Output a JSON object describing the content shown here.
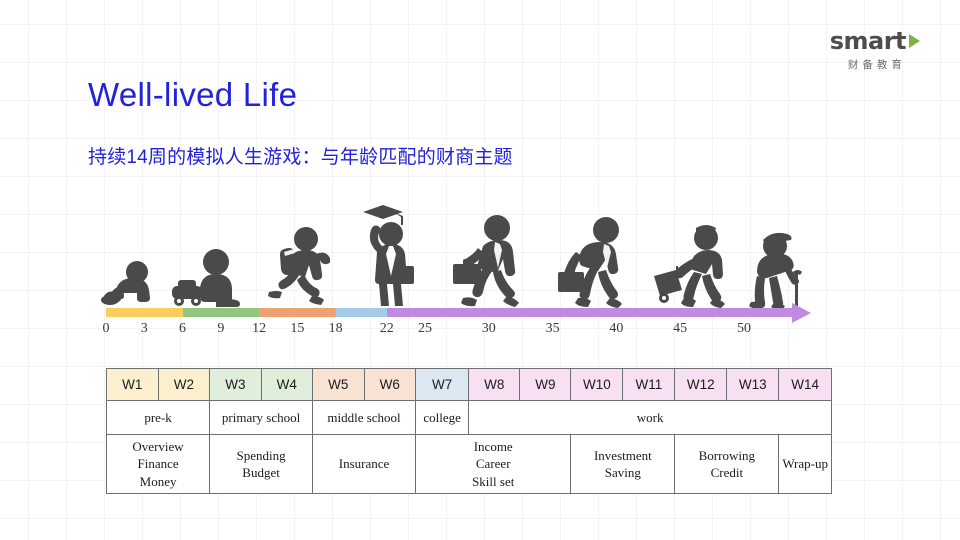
{
  "logo": {
    "wordmark": "smart",
    "chinese": "财备教育",
    "accent_color": "#7cb342",
    "icon": "play-triangle-icon"
  },
  "heading": {
    "title": "Well-lived Life",
    "subtitle": "持续14周的模拟人生游戏：与年龄匹配的财商主题",
    "color": "#2222dd"
  },
  "timeline": {
    "ticks": [
      0,
      3,
      6,
      9,
      12,
      15,
      18,
      22,
      25,
      30,
      35,
      40,
      45,
      50
    ],
    "axis_max": 54,
    "segments": [
      {
        "label": "early-childhood",
        "from": 0,
        "to": 6,
        "color": "#f8ce5c"
      },
      {
        "label": "primary",
        "from": 6,
        "to": 12,
        "color": "#94c77e"
      },
      {
        "label": "middle",
        "from": 12,
        "to": 18,
        "color": "#f0a172"
      },
      {
        "label": "college",
        "from": 18,
        "to": 22,
        "color": "#a6cbe8"
      },
      {
        "label": "work",
        "from": 22,
        "to": 54,
        "color": "#c08ae0"
      }
    ],
    "figures": [
      {
        "name": "crawling-baby-icon",
        "age": 2
      },
      {
        "name": "toddler-with-toy-car-icon",
        "age": 8
      },
      {
        "name": "running-schoolkid-icon",
        "age": 15
      },
      {
        "name": "graduate-icon",
        "age": 22
      },
      {
        "name": "business-person-icon",
        "age": 30
      },
      {
        "name": "worker-with-briefcase-icon",
        "age": 38
      },
      {
        "name": "traveler-with-suitcase-icon",
        "age": 46
      },
      {
        "name": "elderly-with-cane-icon",
        "age": 53
      }
    ]
  },
  "table": {
    "weeks": [
      {
        "label": "W1",
        "color": "#fbefcd"
      },
      {
        "label": "W2",
        "color": "#fbefcd"
      },
      {
        "label": "W3",
        "color": "#e0eedc"
      },
      {
        "label": "W4",
        "color": "#e0eedc"
      },
      {
        "label": "W5",
        "color": "#f8e2d4"
      },
      {
        "label": "W6",
        "color": "#f8e2d4"
      },
      {
        "label": "W7",
        "color": "#dbe8f2"
      },
      {
        "label": "W8",
        "color": "#f7e0f4"
      },
      {
        "label": "W9",
        "color": "#f7e0f4"
      },
      {
        "label": "W10",
        "color": "#f7e0f4"
      },
      {
        "label": "W11",
        "color": "#f7e0f4"
      },
      {
        "label": "W12",
        "color": "#f7e0f4"
      },
      {
        "label": "W13",
        "color": "#f7e0f4"
      },
      {
        "label": "W14",
        "color": "#f7e0f4"
      }
    ],
    "stages": [
      {
        "label": "pre-k",
        "span": 2
      },
      {
        "label": "primary school",
        "span": 2
      },
      {
        "label": "middle school",
        "span": 2
      },
      {
        "label": "college",
        "span": 1
      },
      {
        "label": "work",
        "span": 7
      }
    ],
    "topics": [
      {
        "line1": "Overview",
        "line2": "Finance",
        "line3": "Money",
        "span": 2
      },
      {
        "line1": "Spending",
        "line2": "Budget",
        "line3": "",
        "span": 2
      },
      {
        "line1": "Insurance",
        "line2": "",
        "line3": "",
        "span": 2
      },
      {
        "line1": "Income",
        "line2": "Career",
        "line3": "Skill set",
        "span": 3
      },
      {
        "line1": "Investment",
        "line2": "Saving",
        "line3": "",
        "span": 2
      },
      {
        "line1": "Borrowing",
        "line2": "Credit",
        "line3": "",
        "span": 2
      },
      {
        "line1": "Wrap-up",
        "line2": "",
        "line3": "",
        "span": 1
      }
    ]
  }
}
